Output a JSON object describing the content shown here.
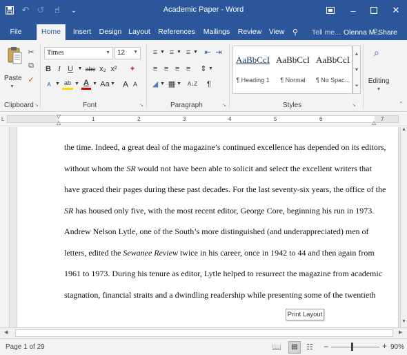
{
  "window": {
    "title": "Academic Paper - Word"
  },
  "tabs": [
    {
      "label": "File"
    },
    {
      "label": "Home"
    },
    {
      "label": "Insert"
    },
    {
      "label": "Design"
    },
    {
      "label": "Layout"
    },
    {
      "label": "References"
    },
    {
      "label": "Mailings"
    },
    {
      "label": "Review"
    },
    {
      "label": "View"
    }
  ],
  "active_tab": "Home",
  "tell_me": "Tell me...",
  "user_name": "Olenna M...",
  "share_label": "Share",
  "ribbon": {
    "clipboard": {
      "paste_label": "Paste",
      "group_label": "Clipboard"
    },
    "font": {
      "name": "Times",
      "size": "12",
      "bold": "B",
      "italic": "I",
      "underline": "U",
      "strike": "abc",
      "subscript": "x₂",
      "superscript": "x²",
      "change_case": "Aa",
      "grow": "A",
      "shrink": "A",
      "group_label": "Font"
    },
    "paragraph": {
      "sort_icon": "A↓Z",
      "pilcrow": "¶",
      "group_label": "Paragraph"
    },
    "styles": {
      "items": [
        {
          "sample": "AaBbCcI",
          "name": "¶ Heading 1"
        },
        {
          "sample": "AaBbCcI",
          "name": "¶ Normal"
        },
        {
          "sample": "AaBbCcI",
          "name": "¶ No Spac..."
        }
      ],
      "group_label": "Styles"
    },
    "editing": {
      "label": "Editing"
    }
  },
  "ruler": {
    "numbers": [
      "1",
      "2",
      "3",
      "4",
      "5",
      "6",
      "7"
    ]
  },
  "document": {
    "lines": [
      [
        {
          "t": "the time. Indeed, a great deal of the magazine’s continued excellence has depended on its editors,",
          "i": false
        }
      ],
      [
        {
          "t": "without whom the ",
          "i": false
        },
        {
          "t": "SR",
          "i": true
        },
        {
          "t": " would not have been able to solicit and select the excellent writers that",
          "i": false
        }
      ],
      [
        {
          "t": "have graced their pages during these past decades. For the last seventy-six years, the office of the",
          "i": false
        }
      ],
      [
        {
          "t": "SR",
          "i": true
        },
        {
          "t": " has housed only five, with the most recent editor, George Core, beginning his run in 1973.",
          "i": false
        }
      ],
      [
        {
          "t": "Andrew Nelson Lytle, one of the South’s more distinguished (and underappreciated) men of",
          "i": false
        }
      ],
      [
        {
          "t": "letters, edited the ",
          "i": false
        },
        {
          "t": "Sewanee Review",
          "i": true
        },
        {
          "t": " twice in his career, once in 1942 to 44 and then again from",
          "i": false
        }
      ],
      [
        {
          "t": "1961 to 1973. During his tenure as editor, Lytle helped to resurrect the magazine from academic",
          "i": false
        }
      ],
      [
        {
          "t": "stagnation, financial straits and a dwindling readership while presenting some of the twentieth",
          "i": false
        }
      ]
    ]
  },
  "status": {
    "page_info": "Page 1 of 29",
    "tooltip": "Print Layout",
    "zoom": "90%",
    "zoom_minus": "−",
    "zoom_plus": "+"
  },
  "colors": {
    "accent": "#2b579a",
    "ribbon_bg": "#f3f3f3",
    "doc_bg": "#e9e9e9"
  }
}
